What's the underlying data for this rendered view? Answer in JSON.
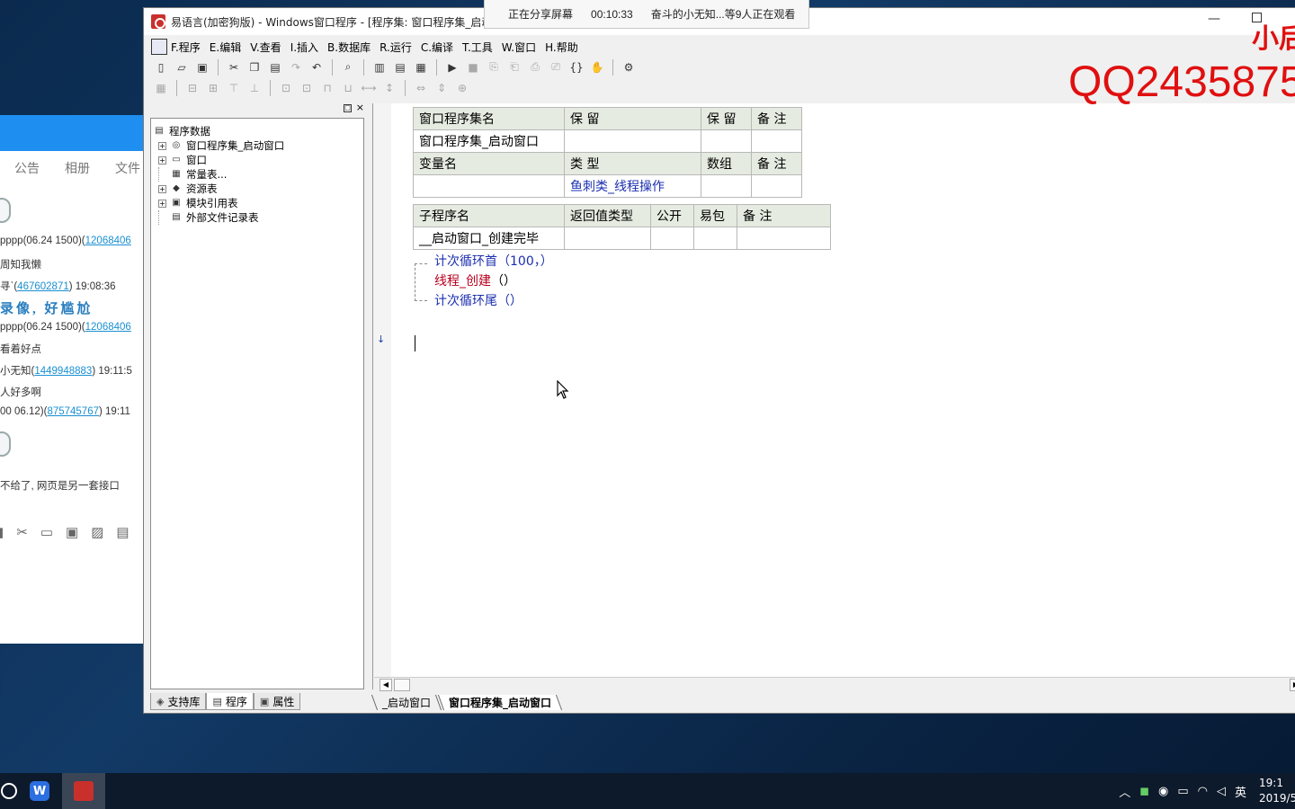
{
  "share_banner": {
    "status": "正在分享屏幕",
    "elapsed": "00:10:33",
    "viewers": "奋斗的小无知...等9人正在观看"
  },
  "watermark": {
    "name": "小后",
    "qq": "QQ2435875"
  },
  "qq_chat": {
    "tabs": [
      "公告",
      "相册",
      "文件"
    ],
    "messages": [
      {
        "text": "pppp(06.24 1500)(",
        "qq": "12068406",
        "time": ""
      },
      {
        "text": "周知我懒",
        "qq": "",
        "time": ""
      },
      {
        "text": "寻ˋ(",
        "qq": "467602871",
        "time": ")  19:08:36"
      },
      {
        "text": "录像, 好尴尬",
        "qq": "",
        "time": "",
        "big": true
      },
      {
        "text": "pppp(06.24 1500)(",
        "qq": "12068406",
        "time": ""
      },
      {
        "text": "看着好点",
        "qq": "",
        "time": ""
      },
      {
        "text": "小无知(",
        "qq": "1449948883",
        "time": ")  19:11:5"
      },
      {
        "text": "人好多啊",
        "qq": "",
        "time": ""
      },
      {
        "text": "00 06.12)(",
        "qq": "875745767",
        "time": ")  19:11"
      },
      {
        "text": "不给了, 网页是另一套接口",
        "qq": "",
        "time": ""
      }
    ]
  },
  "ide": {
    "window_title": "易语言(加密狗版) - Windows窗口程序 - [程序集: 窗口程序集_启动",
    "menu": [
      "F.程序",
      "E.编辑",
      "V.查看",
      "I.插入",
      "B.数据库",
      "R.运行",
      "C.编译",
      "T.工具",
      "W.窗口",
      "H.帮助"
    ],
    "tree": {
      "root": "程序数据",
      "children": [
        {
          "label": "窗口程序集_启动窗口",
          "expandable": true,
          "icon": "assembly-icon"
        },
        {
          "label": "窗口",
          "expandable": true,
          "icon": "window-icon"
        },
        {
          "label": "常量表...",
          "expandable": false,
          "icon": "constant-icon"
        },
        {
          "label": "资源表",
          "expandable": true,
          "icon": "resource-icon"
        },
        {
          "label": "模块引用表",
          "expandable": true,
          "icon": "module-icon"
        },
        {
          "label": "外部文件记录表",
          "expandable": false,
          "icon": "file-icon"
        }
      ]
    },
    "panel_tabs": [
      "支持库",
      "程序",
      "属性"
    ],
    "assembly_table": {
      "headers": [
        "窗口程序集名",
        "保 留",
        "保 留",
        "备 注"
      ],
      "row": [
        "窗口程序集_启动窗口",
        "",
        "",
        ""
      ]
    },
    "var_table": {
      "headers": [
        "变量名",
        "类 型",
        "数组",
        "备 注"
      ],
      "row": [
        "",
        "鱼刺类_线程操作",
        "",
        ""
      ]
    },
    "sub_table": {
      "headers": [
        "子程序名",
        "返回值类型",
        "公开",
        "易包",
        "备 注"
      ],
      "row": [
        "__启动窗口_创建完毕",
        "",
        "",
        "",
        ""
      ]
    },
    "code": [
      {
        "kw": "计次循环首",
        "args": "（100，）"
      },
      {
        "fn": "线程_创建",
        "args": "（）"
      },
      {
        "kw": "计次循环尾",
        "args": "（）"
      }
    ],
    "doc_tabs": [
      "_启动窗口",
      "窗口程序集_启动窗口"
    ]
  },
  "taskbar": {
    "tray_lang": "英",
    "clock_time": "19:1",
    "clock_date": "2019/5"
  }
}
